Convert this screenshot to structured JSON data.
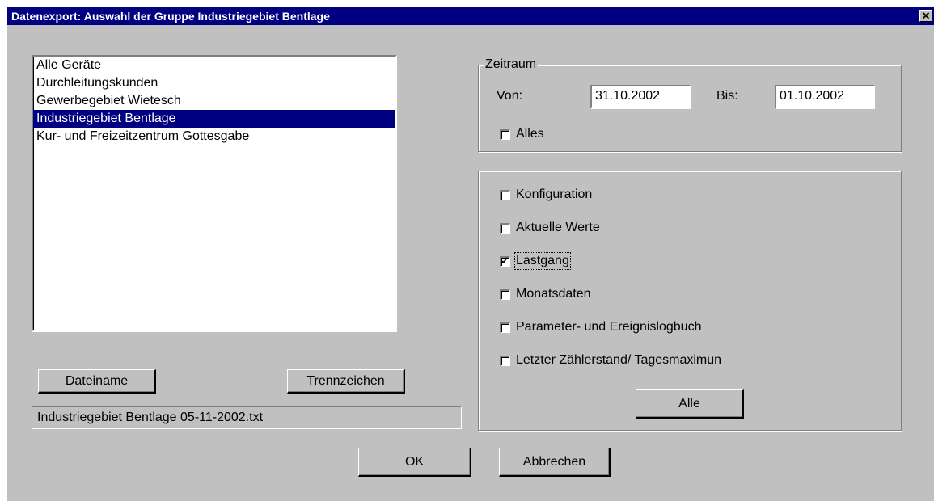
{
  "window": {
    "title": "Datenexport: Auswahl der Gruppe Industriegebiet Bentlage",
    "close_label": "✕"
  },
  "groups": {
    "items": [
      {
        "label": "Alle Geräte",
        "selected": false
      },
      {
        "label": "Durchleitungskunden",
        "selected": false
      },
      {
        "label": "Gewerbegebiet Wietesch",
        "selected": false
      },
      {
        "label": "Industriegebiet Bentlage",
        "selected": true
      },
      {
        "label": "Kur- und Freizeitzentrum Gottesgabe",
        "selected": false
      }
    ]
  },
  "file": {
    "dateiname_label": "Dateiname",
    "trennzeichen_label": "Trennzeichen",
    "filename_value": "Industriegebiet Bentlage 05-11-2002.txt"
  },
  "zeitraum": {
    "legend": "Zeitraum",
    "von_label": "Von:",
    "von_value": "31.10.2002",
    "bis_label": "Bis:",
    "bis_value": "01.10.2002",
    "alles_label": "Alles",
    "alles_checked": false
  },
  "datatypes": {
    "options": [
      {
        "label": "Konfiguration",
        "checked": false
      },
      {
        "label": "Aktuelle Werte",
        "checked": false
      },
      {
        "label": "Lastgang",
        "checked": true
      },
      {
        "label": "Monatsdaten",
        "checked": false
      },
      {
        "label": "Parameter- und Ereignislogbuch",
        "checked": false
      },
      {
        "label": "Letzter Zählerstand/ Tagesmaximun",
        "checked": false
      }
    ],
    "alle_label": "Alle"
  },
  "actions": {
    "ok_label": "OK",
    "cancel_label": "Abbrechen"
  },
  "colors": {
    "titlebar": "#000080",
    "face": "#c0c0c0",
    "selection": "#000080"
  }
}
